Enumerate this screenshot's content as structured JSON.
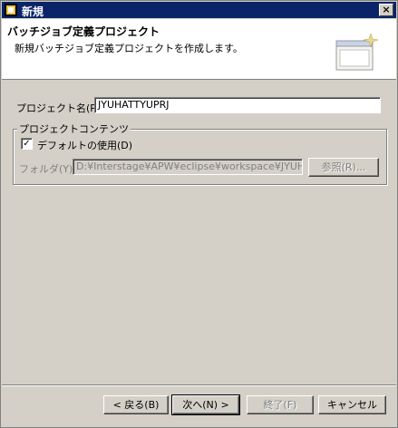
{
  "window": {
    "title": "新規",
    "close_label": "×"
  },
  "header": {
    "title": "バッチジョブ定義プロジェクト",
    "description": "新規バッチジョブ定義プロジェクトを作成します。"
  },
  "form": {
    "project_name_label": "プロジェクト名(P):",
    "project_name_value": "JYUHATTYUPRJ",
    "group_title": "プロジェクトコンテンツ",
    "use_default_label": "デフォルトの使用(D)",
    "use_default_checked": "✓",
    "folder_label": "フォルダ(Y):",
    "folder_value": "D:¥Interstage¥APW¥eclipse¥workspace¥JYUHAT",
    "browse_label": "参照(R)..."
  },
  "buttons": {
    "back": "< 戻る(B)",
    "next": "次へ(N) >",
    "finish": "終了(F)",
    "cancel": "キャンセル"
  }
}
